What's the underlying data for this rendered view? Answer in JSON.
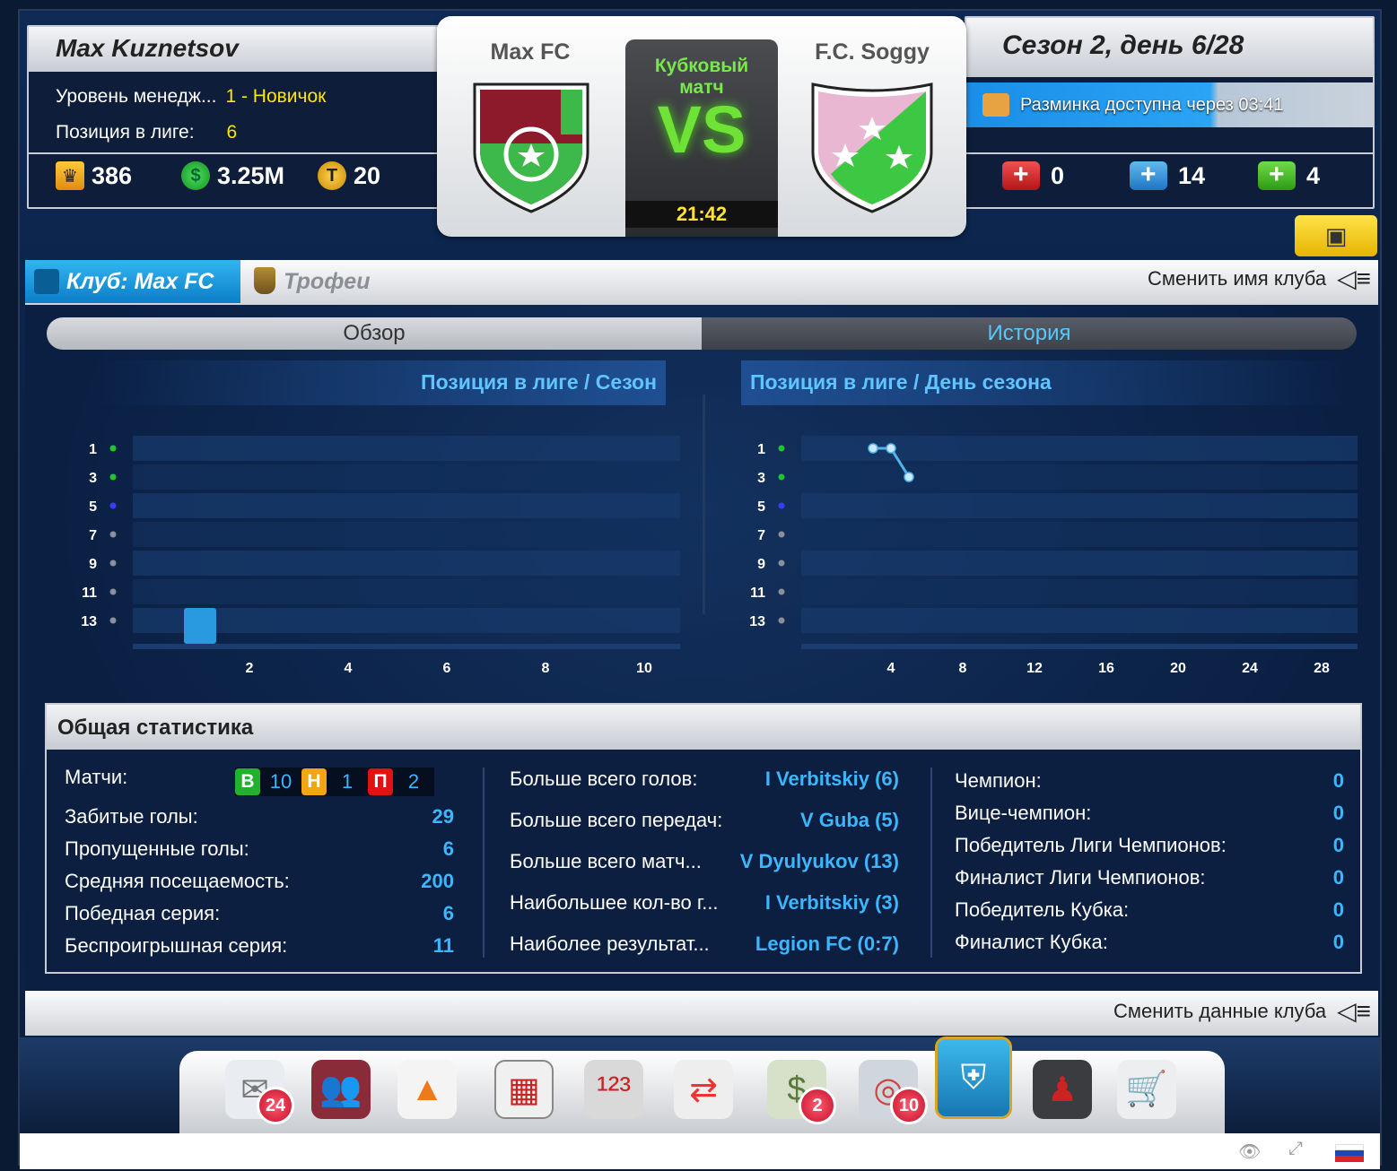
{
  "manager": {
    "name": "Max Kuznetsov",
    "level_label": "Уровень менедж...",
    "level_value": "1 - Новичок",
    "position_label": "Позиция в лиге:",
    "position_value": "6",
    "trophies": "386",
    "cash": "3.25M",
    "tokens": "20"
  },
  "match": {
    "home_team": "Max FC",
    "away_team": "F.C. Soggy",
    "type_line1": "Кубковый",
    "type_line2": "матч",
    "vs": "VS",
    "time": "21:42"
  },
  "season": {
    "title": "Сезон 2, день 6/28",
    "warmup": "Разминка доступна через 03:41",
    "kits": {
      "red": "0",
      "blue": "14",
      "green": "4"
    }
  },
  "club_tabs": {
    "club": "Клуб: Max FC",
    "trophies": "Трофеи",
    "rename": "Сменить имя клуба"
  },
  "subtabs": {
    "overview": "Обзор",
    "history": "История"
  },
  "chart_data": [
    {
      "type": "bar",
      "title": "Позиция в лиге / Сезон",
      "y_ticks": [
        "1",
        "3",
        "5",
        "7",
        "9",
        "11",
        "13"
      ],
      "y_tick_colors": [
        "#22c42d",
        "#22c42d",
        "#3b3bff",
        "#8a8f99",
        "#8a8f99",
        "#8a8f99",
        "#8a8f99"
      ],
      "x_ticks": [
        "2",
        "4",
        "6",
        "8",
        "10"
      ],
      "ylim": [
        1,
        13
      ],
      "y_inverted": true,
      "series": [
        {
          "x": [
            1
          ],
          "values": [
            13
          ]
        }
      ]
    },
    {
      "type": "line",
      "title": "Позиция в лиге / День сезона",
      "y_ticks": [
        "1",
        "3",
        "5",
        "7",
        "9",
        "11",
        "13"
      ],
      "y_tick_colors": [
        "#22c42d",
        "#22c42d",
        "#3b3bff",
        "#8a8f99",
        "#8a8f99",
        "#8a8f99",
        "#8a8f99"
      ],
      "x_ticks": [
        "4",
        "8",
        "12",
        "16",
        "20",
        "24",
        "28"
      ],
      "ylim": [
        1,
        13
      ],
      "y_inverted": true,
      "series": [
        {
          "x": [
            3,
            4,
            5
          ],
          "values": [
            1,
            1,
            3
          ]
        }
      ]
    }
  ],
  "stats": {
    "title": "Общая статистика",
    "matches_label": "Матчи:",
    "w_letter": "В",
    "w": "10",
    "d_letter": "Н",
    "d": "1",
    "l_letter": "П",
    "l": "2",
    "left": [
      {
        "label": "Забитые голы:",
        "value": "29"
      },
      {
        "label": "Пропущенные голы:",
        "value": "6"
      },
      {
        "label": "Средняя посещаемость:",
        "value": "200"
      },
      {
        "label": "Победная серия:",
        "value": "6"
      },
      {
        "label": "Беспроигрышная серия:",
        "value": "11"
      }
    ],
    "middle": [
      {
        "label": "Больше всего голов:",
        "value": "I Verbitskiy (6)"
      },
      {
        "label": "Больше всего передач:",
        "value": "V Guba (5)"
      },
      {
        "label": "Больше всего матч...",
        "value": "V Dyulyukov (13)"
      },
      {
        "label": "Наибольшее кол-во г...",
        "value": "I Verbitskiy (3)"
      },
      {
        "label": "Наиболее результат...",
        "value": "Legion FC (0:7)"
      }
    ],
    "right": [
      {
        "label": "Чемпион:",
        "value": "0"
      },
      {
        "label": "Вице-чемпион:",
        "value": "0"
      },
      {
        "label": "Победитель Лиги Чемпионов:",
        "value": "0"
      },
      {
        "label": "Финалист Лиги Чемпионов:",
        "value": "0"
      },
      {
        "label": "Победитель Кубка:",
        "value": "0"
      },
      {
        "label": "Финалист Кубка:",
        "value": "0"
      }
    ]
  },
  "footer": {
    "change_data": "Сменить данные клуба"
  },
  "dock": {
    "mail_badge": "24",
    "finance_badge": "2",
    "stadium_badge": "10"
  },
  "colors": {
    "accent_blue": "#3cb6ff",
    "vs_green": "#6ee336",
    "yellow": "#ffe600",
    "badge_red": "#c3102a"
  }
}
